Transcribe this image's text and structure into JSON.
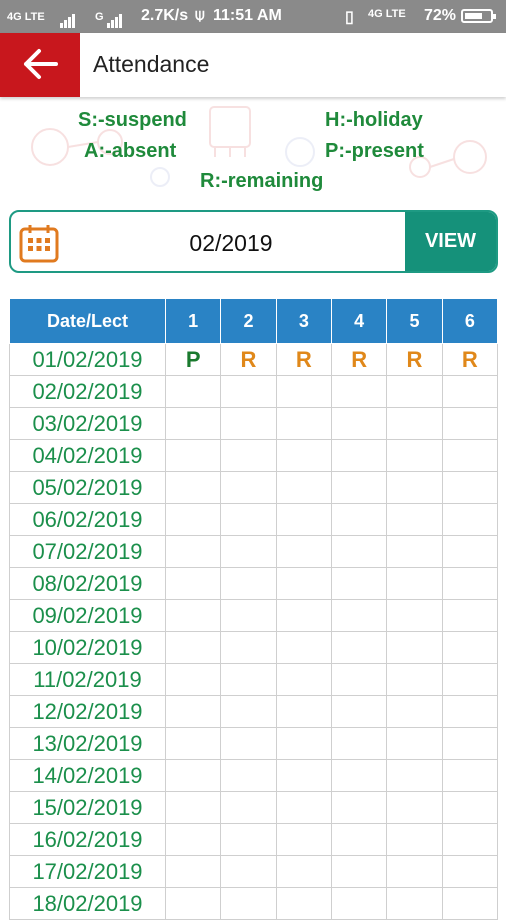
{
  "status_bar": {
    "left_net": "4G LTE",
    "left_g": "G",
    "speed": "2.7K/s",
    "time": "11:51 AM",
    "right_net": "4G LTE",
    "battery": "72%",
    "battery_level": 0.72
  },
  "app_bar": {
    "title": "Attendance",
    "back_icon": "arrow-left-icon"
  },
  "legend": {
    "suspend": "S:-suspend",
    "holiday": "H:-holiday",
    "absent": "A:-absent",
    "present": "P:-present",
    "remaining": "R:-remaining"
  },
  "month_selector": {
    "icon": "calendar-icon",
    "value": "02/2019",
    "view_label": "VIEW"
  },
  "table": {
    "header": [
      "Date/Lect",
      "1",
      "2",
      "3",
      "4",
      "5",
      "6"
    ],
    "rows": [
      {
        "date": "01/02/2019",
        "marks": [
          "P",
          "R",
          "R",
          "R",
          "R",
          "R"
        ]
      },
      {
        "date": "02/02/2019",
        "marks": [
          "",
          "",
          "",
          "",
          "",
          ""
        ]
      },
      {
        "date": "03/02/2019",
        "marks": [
          "",
          "",
          "",
          "",
          "",
          ""
        ]
      },
      {
        "date": "04/02/2019",
        "marks": [
          "",
          "",
          "",
          "",
          "",
          ""
        ]
      },
      {
        "date": "05/02/2019",
        "marks": [
          "",
          "",
          "",
          "",
          "",
          ""
        ]
      },
      {
        "date": "06/02/2019",
        "marks": [
          "",
          "",
          "",
          "",
          "",
          ""
        ]
      },
      {
        "date": "07/02/2019",
        "marks": [
          "",
          "",
          "",
          "",
          "",
          ""
        ]
      },
      {
        "date": "08/02/2019",
        "marks": [
          "",
          "",
          "",
          "",
          "",
          ""
        ]
      },
      {
        "date": "09/02/2019",
        "marks": [
          "",
          "",
          "",
          "",
          "",
          ""
        ]
      },
      {
        "date": "10/02/2019",
        "marks": [
          "",
          "",
          "",
          "",
          "",
          ""
        ]
      },
      {
        "date": "11/02/2019",
        "marks": [
          "",
          "",
          "",
          "",
          "",
          ""
        ]
      },
      {
        "date": "12/02/2019",
        "marks": [
          "",
          "",
          "",
          "",
          "",
          ""
        ]
      },
      {
        "date": "13/02/2019",
        "marks": [
          "",
          "",
          "",
          "",
          "",
          ""
        ]
      },
      {
        "date": "14/02/2019",
        "marks": [
          "",
          "",
          "",
          "",
          "",
          ""
        ]
      },
      {
        "date": "15/02/2019",
        "marks": [
          "",
          "",
          "",
          "",
          "",
          ""
        ]
      },
      {
        "date": "16/02/2019",
        "marks": [
          "",
          "",
          "",
          "",
          "",
          ""
        ]
      },
      {
        "date": "17/02/2019",
        "marks": [
          "",
          "",
          "",
          "",
          "",
          ""
        ]
      },
      {
        "date": "18/02/2019",
        "marks": [
          "",
          "",
          "",
          "",
          "",
          ""
        ]
      }
    ]
  },
  "colors": {
    "app_red": "#c8171d",
    "teal": "#15917a",
    "header_blue": "#2a83c5",
    "legend_green": "#1f8a3b",
    "present_green": "#1a7a2e",
    "remaining_orange": "#e0881a"
  }
}
